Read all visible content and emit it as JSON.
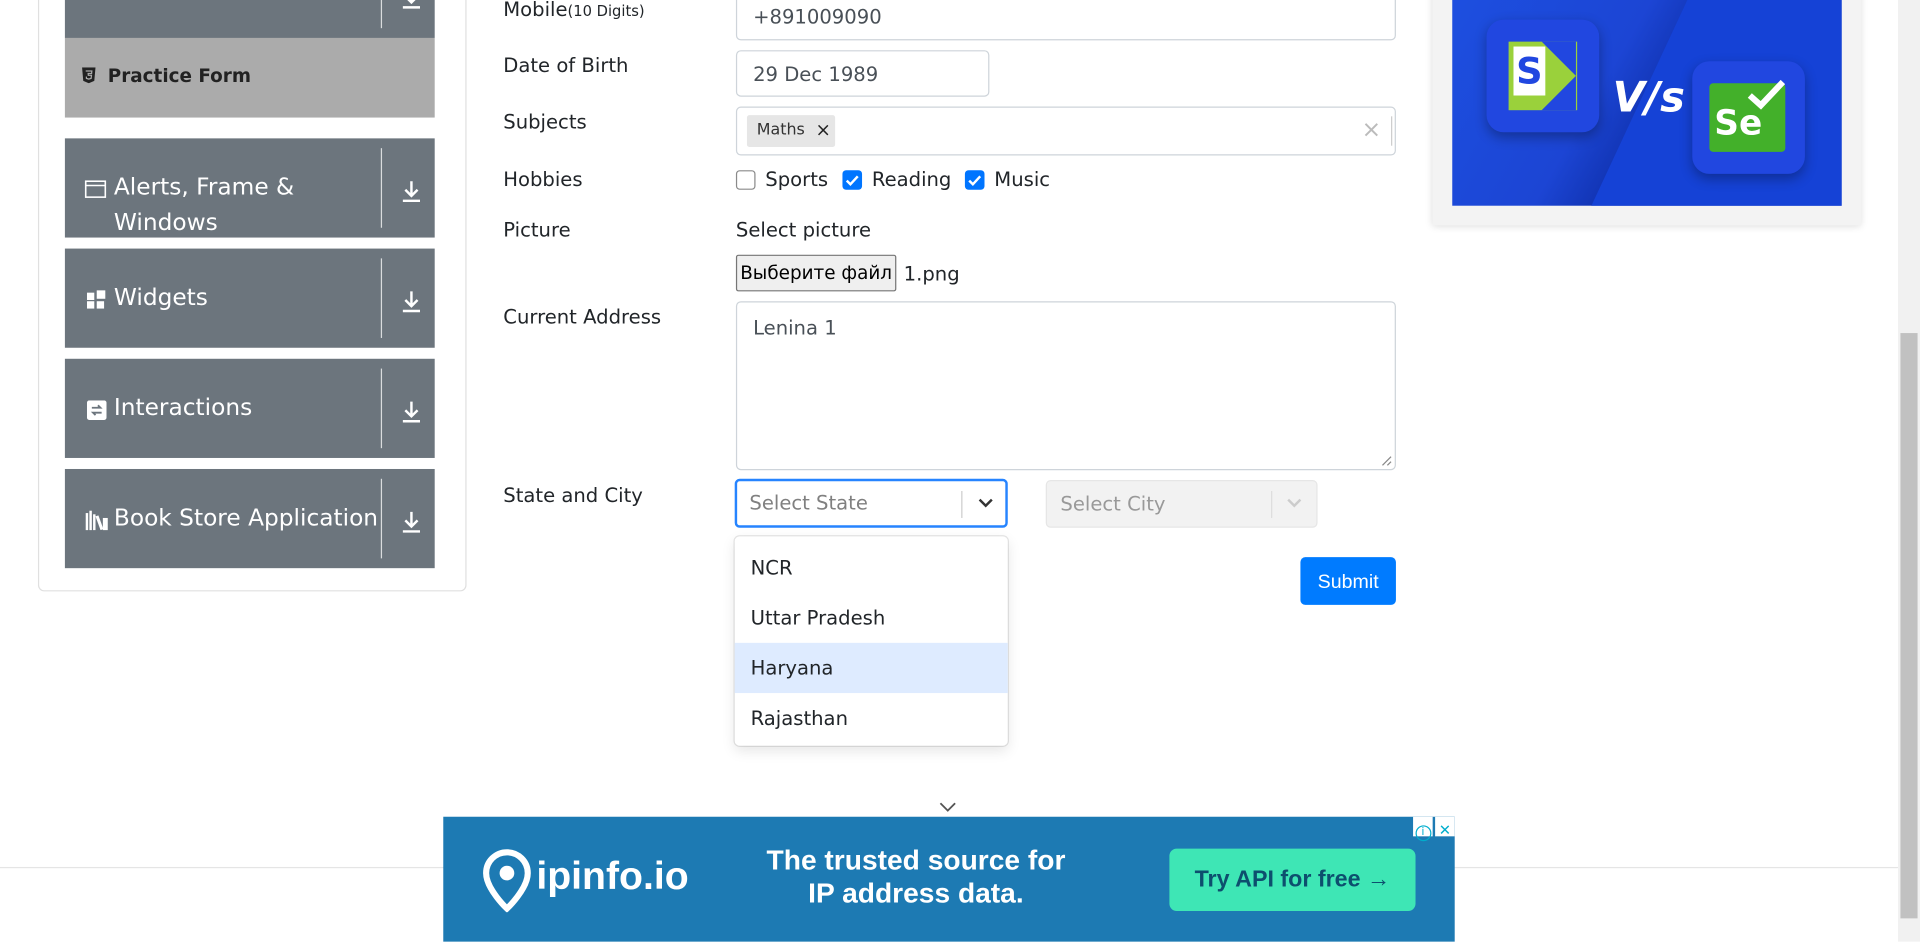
{
  "sidebar": {
    "practice_form": "Practice Form",
    "groups": [
      {
        "label_line1": "Alerts, Frame &",
        "label_line2": "Windows",
        "icon": "window-icon"
      },
      {
        "label": "Widgets",
        "icon": "widgets-icon"
      },
      {
        "label": "Interactions",
        "icon": "interactions-icon"
      },
      {
        "label": "Book Store Application",
        "icon": "books-icon"
      }
    ]
  },
  "form": {
    "mobile_label": "Mobile",
    "mobile_hint": "(10 Digits)",
    "mobile_value": "+891009090",
    "dob_label": "Date of Birth",
    "dob_value": "29 Dec 1989",
    "subjects_label": "Subjects",
    "subject_chip": "Maths",
    "chip_remove": "×",
    "subjects_clear": "×",
    "hobbies_label": "Hobbies",
    "hobbies": [
      {
        "label": "Sports",
        "checked": false
      },
      {
        "label": "Reading",
        "checked": true
      },
      {
        "label": "Music",
        "checked": true
      }
    ],
    "picture_label": "Picture",
    "select_picture": "Select picture",
    "file_button": "Выберите файл",
    "file_name": "1.png",
    "address_label": "Current Address",
    "address_value": "Lenina 1",
    "state_city_label": "State and City",
    "state_placeholder": "Select State",
    "city_placeholder": "Select City",
    "state_options": [
      "NCR",
      "Uttar Pradesh",
      "Haryana",
      "Rajasthan"
    ],
    "highlighted_option": "Haryana",
    "submit": "Submit"
  },
  "ads": {
    "right_vs": "V/s",
    "banner_brand": "ipinfo.io",
    "banner_line1": "The trusted source for",
    "banner_line2": "IP address data.",
    "banner_cta": "Try API for free →",
    "banner_close": "✕",
    "banner_info": "i"
  },
  "colors": {
    "primary": "#007bff",
    "sidebar_group": "#6c757d",
    "sidebar_active": "#ababab",
    "checkbox_checked": "#0075ff",
    "option_highlight": "#deebff",
    "banner_bg": "#1d7ab3",
    "banner_cta_bg": "#3ee6b5"
  }
}
